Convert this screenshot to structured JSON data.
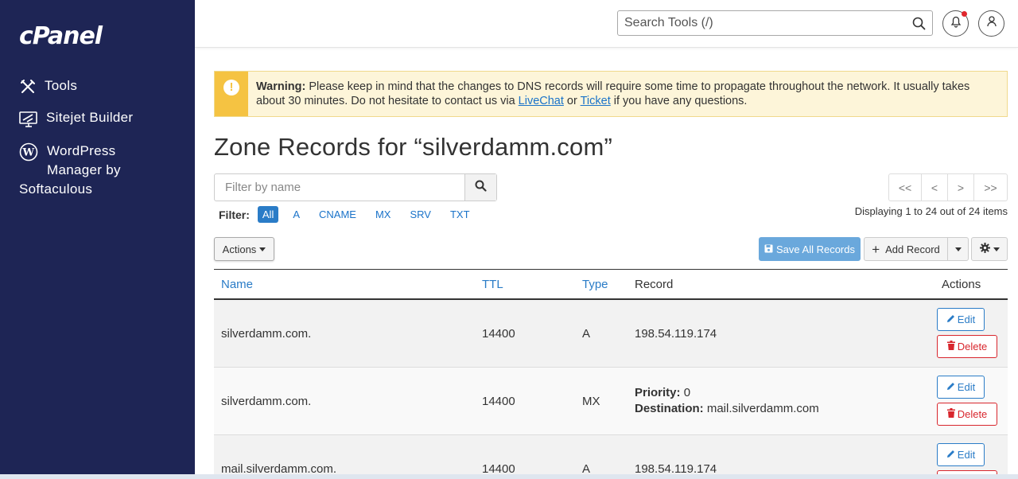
{
  "sidebar": {
    "logo": "cPanel",
    "items": [
      {
        "label": "Tools",
        "icon": "tools-icon"
      },
      {
        "label": "Sitejet Builder",
        "icon": "sitejet-icon"
      },
      {
        "label_lines": [
          "WordPress",
          "Manager by",
          "Softaculous"
        ],
        "icon": "wordpress-icon"
      }
    ]
  },
  "header": {
    "search_placeholder": "Search Tools (/)"
  },
  "warning": {
    "label": "Warning:",
    "text_before": " Please keep in mind that the changes to DNS records will require some time to propagate throughout the network. It usually takes about 30 minutes. Do not hesitate to contact us via ",
    "link1": "LiveChat",
    "text_middle": " or ",
    "link2": "Ticket",
    "text_after": " if you have any questions."
  },
  "page_title": "Zone Records for “silverdamm.com”",
  "filter": {
    "placeholder": "Filter by name",
    "label": "Filter:",
    "options": [
      "All",
      "A",
      "CNAME",
      "MX",
      "SRV",
      "TXT"
    ],
    "active": "All"
  },
  "pagination": {
    "first": "<<",
    "prev": "<",
    "next": ">",
    "last": ">>",
    "displaying_prefix": "Displaying ",
    "from": "1",
    "to_text": " to ",
    "to": "24",
    "out_of_text": " out of ",
    "total": "24",
    "suffix": " items"
  },
  "toolbar": {
    "actions_label": "Actions",
    "save_label": "Save All Records",
    "add_label": "Add Record"
  },
  "table": {
    "columns": [
      "Name",
      "TTL",
      "Type",
      "Record",
      "Actions"
    ],
    "rows": [
      {
        "name": "silverdamm.com.",
        "ttl": "14400",
        "type": "A",
        "record": "198.54.119.174"
      },
      {
        "name": "silverdamm.com.",
        "ttl": "14400",
        "type": "MX",
        "priority_label": "Priority:",
        "priority": "0",
        "destination_label": "Destination:",
        "destination": "mail.silverdamm.com"
      },
      {
        "name": "mail.silverdamm.com.",
        "ttl": "14400",
        "type": "A",
        "record": "198.54.119.174"
      }
    ],
    "edit_label": "Edit",
    "delete_label": "Delete"
  },
  "colors": {
    "sidebar_bg": "#1e2555",
    "accent": "#2a7cc7",
    "warning_bar": "#f5c342",
    "danger": "#d8262d"
  }
}
